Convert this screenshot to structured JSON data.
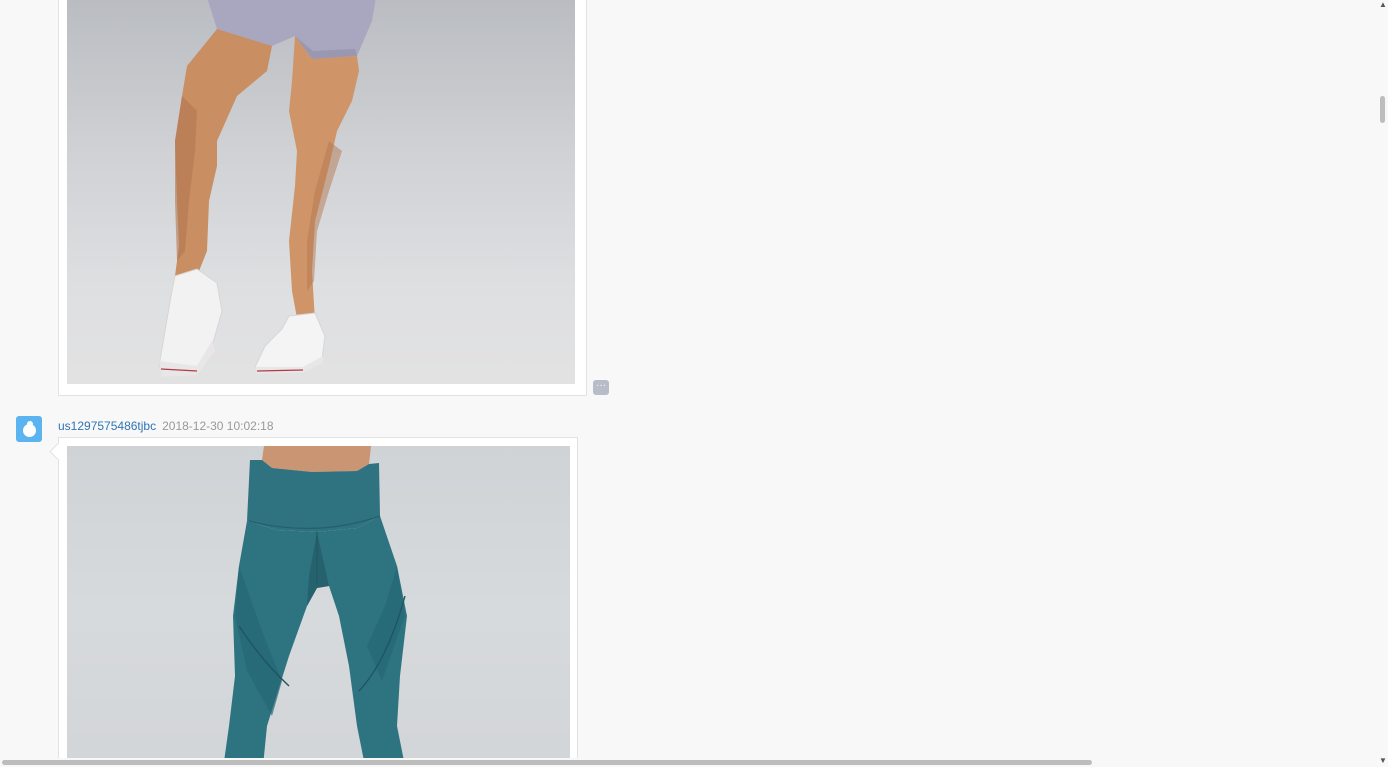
{
  "messages": [
    {
      "image_alt": "Legs in lavender shorts and white sneakers",
      "more_label": "···"
    },
    {
      "username": "us1297575486tjbc",
      "timestamp": "2018-12-30 10:02:18",
      "image_alt": "Teal leggings"
    }
  ],
  "colors": {
    "background": "#f8f8f8",
    "username": "#2f74b5",
    "timestamp": "#999999",
    "avatar": "#5bb4f0",
    "more_button": "#b7bcc8"
  },
  "icons": {
    "avatar": "user-avatar-icon",
    "more": "more-options-icon",
    "scroll_up": "scroll-up-arrow-icon",
    "scroll_down": "scroll-down-arrow-icon"
  },
  "scrollbars": {
    "vertical_arrow_up": "▲",
    "vertical_arrow_down": "▼"
  }
}
